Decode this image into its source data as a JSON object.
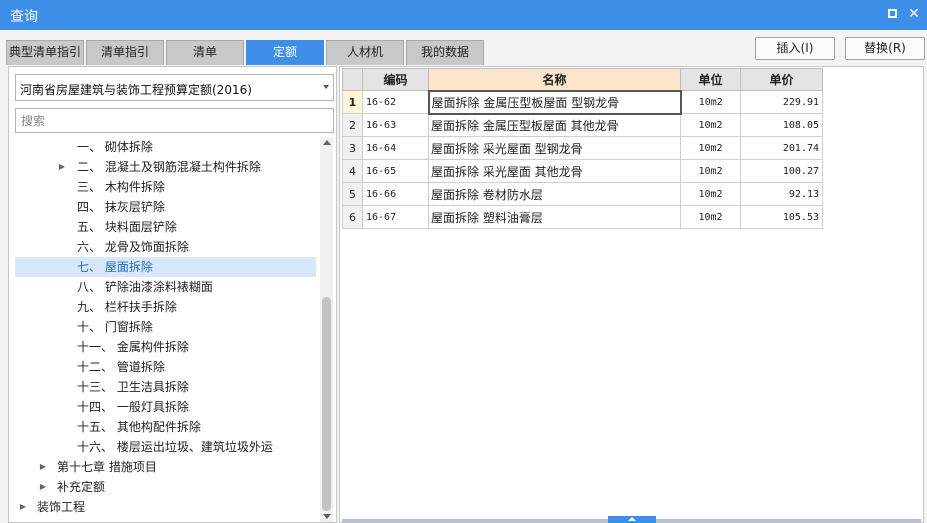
{
  "window": {
    "title": "查询"
  },
  "tabs": [
    {
      "label": "典型清单指引"
    },
    {
      "label": "清单指引"
    },
    {
      "label": "清单"
    },
    {
      "label": "定额"
    },
    {
      "label": "人材机"
    },
    {
      "label": "我的数据"
    }
  ],
  "active_tab": "定额",
  "actions": {
    "insert_label": "插入(I)",
    "replace_label": "替换(R)"
  },
  "library": {
    "selected": "河南省房屋建筑与装饰工程预算定额(2016)"
  },
  "search": {
    "placeholder": "搜索",
    "value": ""
  },
  "tree": [
    {
      "label": "一、 砌体拆除",
      "has_children": false
    },
    {
      "label": "二、 混凝土及钢筋混凝土构件拆除",
      "has_children": true
    },
    {
      "label": "三、 木构件拆除",
      "has_children": false
    },
    {
      "label": "四、 抹灰层铲除",
      "has_children": false
    },
    {
      "label": "五、 块料面层铲除",
      "has_children": false
    },
    {
      "label": "六、 龙骨及饰面拆除",
      "has_children": false
    },
    {
      "label": "七、 屋面拆除",
      "has_children": false,
      "selected": true
    },
    {
      "label": "八、 铲除油漆涂料裱糊面",
      "has_children": false
    },
    {
      "label": "九、 栏杆扶手拆除",
      "has_children": false
    },
    {
      "label": "十、 门窗拆除",
      "has_children": false
    },
    {
      "label": "十一、 金属构件拆除",
      "has_children": false
    },
    {
      "label": "十二、 管道拆除",
      "has_children": false
    },
    {
      "label": "十三、 卫生洁具拆除",
      "has_children": false
    },
    {
      "label": "十四、 一般灯具拆除",
      "has_children": false
    },
    {
      "label": "十五、 其他构配件拆除",
      "has_children": false
    },
    {
      "label": "十六、 楼层运出垃圾、建筑垃圾外运",
      "has_children": false
    },
    {
      "label": "第十七章 措施项目",
      "has_children": true
    },
    {
      "label": "补充定额",
      "has_children": true
    },
    {
      "label": "装饰工程",
      "has_children": true
    }
  ],
  "grid": {
    "headers": {
      "code": "编码",
      "name": "名称",
      "unit": "单位",
      "price": "单价"
    },
    "rows": [
      {
        "num": "1",
        "code": "16-62",
        "name": "屋面拆除 金属压型板屋面 型钢龙骨",
        "unit": "10m2",
        "price": "229.91"
      },
      {
        "num": "2",
        "code": "16-63",
        "name": "屋面拆除 金属压型板屋面 其他龙骨",
        "unit": "10m2",
        "price": "108.05"
      },
      {
        "num": "3",
        "code": "16-64",
        "name": "屋面拆除 采光屋面 型钢龙骨",
        "unit": "10m2",
        "price": "201.74"
      },
      {
        "num": "4",
        "code": "16-65",
        "name": "屋面拆除 采光屋面 其他龙骨",
        "unit": "10m2",
        "price": "100.27"
      },
      {
        "num": "5",
        "code": "16-66",
        "name": "屋面拆除 卷材防水层",
        "unit": "10m2",
        "price": "92.13"
      },
      {
        "num": "6",
        "code": "16-67",
        "name": "屋面拆除 塑料油膏层",
        "unit": "10m2",
        "price": "105.53"
      }
    ]
  },
  "colors": {
    "accent": "#3c8ee6",
    "selected_row": "#d6e8fa",
    "name_header": "#fbe6cb"
  },
  "icons": {
    "maximize": "maximize-icon",
    "close": "close-icon",
    "dropdown": "chevron-down-icon",
    "expander": "triangle-right-icon"
  }
}
